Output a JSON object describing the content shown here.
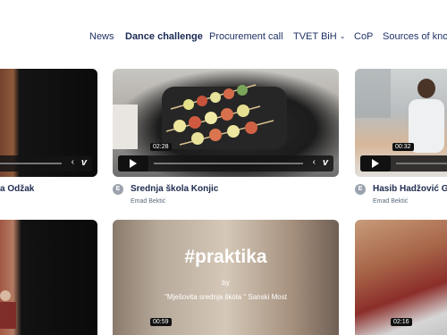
{
  "nav": {
    "items": [
      {
        "label": "News"
      },
      {
        "label": "Dance challenge"
      },
      {
        "label": "Procurement call"
      },
      {
        "label": "TVET BiH"
      },
      {
        "label": "CoP"
      },
      {
        "label": "Sources of know"
      }
    ]
  },
  "videos": [
    {
      "title": "a Odžak",
      "author": "",
      "duration": ""
    },
    {
      "title": "Srednja škola Konjic",
      "author": "Emad Bektić",
      "avatar_letter": "E",
      "duration": "02:28"
    },
    {
      "title": "Hasib Hadžović Go",
      "author": "Emad Bektić",
      "avatar_letter": "E",
      "duration": "00:32"
    },
    {
      "title": "",
      "author": "",
      "duration": ""
    },
    {
      "title": "",
      "author": "",
      "duration": "00:59",
      "overlay_title": "#praktika",
      "overlay_by": "by",
      "overlay_school": "\"Mješovita srednja škola \" Sanski Most"
    },
    {
      "title": "",
      "author": "",
      "duration": "02:16"
    }
  ],
  "icons": {
    "play": "play-icon",
    "vimeo": "vimeo-logo",
    "chevron": "chevron-down-icon"
  },
  "colors": {
    "nav_text": "#1f3266",
    "title_text": "#1d2b4f",
    "author_text": "#5a6a7a"
  }
}
